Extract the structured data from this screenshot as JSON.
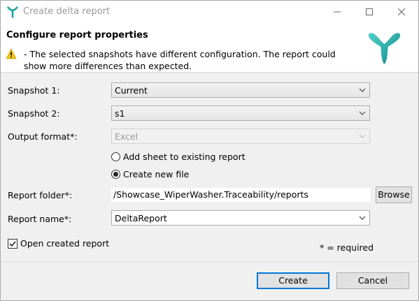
{
  "window": {
    "title": "Create delta report"
  },
  "header": {
    "title": "Configure report properties",
    "warning": " - The selected snapshots have different configuration. The report could show more differences than expected."
  },
  "form": {
    "snapshot1": {
      "label": "Snapshot 1:",
      "value": "Current"
    },
    "snapshot2": {
      "label": "Snapshot 2:",
      "value": "s1"
    },
    "output_format": {
      "label": "Output format*:",
      "value": "Excel"
    },
    "radio_add_sheet": {
      "label": "Add sheet to existing report",
      "selected": false
    },
    "radio_new_file": {
      "label": "Create new file",
      "selected": true
    },
    "report_folder": {
      "label": "Report folder*:",
      "value": "/Showcase_WiperWasher.Traceability/reports"
    },
    "browse_label": "Browse",
    "report_name": {
      "label": "Report name*:",
      "value": "DeltaReport"
    },
    "open_created": {
      "label": "Open created report",
      "checked": true
    },
    "required_note": "* = required"
  },
  "footer": {
    "create_label": "Create",
    "cancel_label": "Cancel"
  },
  "colors": {
    "brand_teal": "#1ba5a6",
    "warning_yellow": "#f5c518",
    "focus_blue": "#0078d7"
  }
}
